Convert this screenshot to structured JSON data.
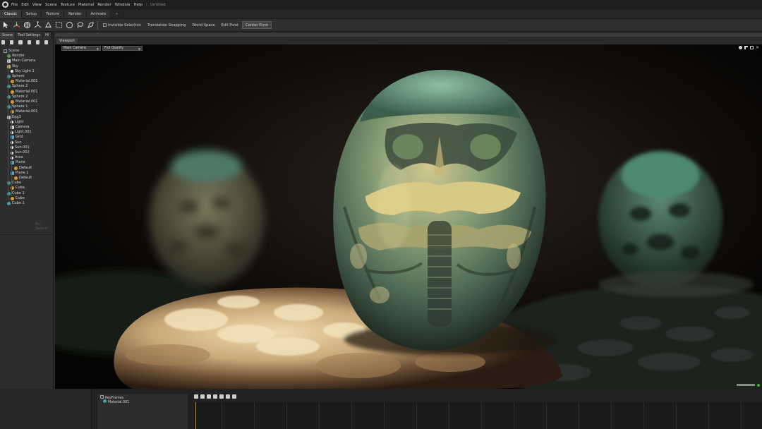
{
  "menubar": {
    "items": [
      "File",
      "Edit",
      "View",
      "Scene",
      "Texture",
      "Material",
      "Render",
      "Window",
      "Help"
    ],
    "document": "Untitled"
  },
  "tabs": {
    "items": [
      {
        "label": "Classic",
        "active": true
      },
      {
        "label": "Setup",
        "active": false
      },
      {
        "label": "Texture",
        "active": false
      },
      {
        "label": "Render",
        "active": false
      },
      {
        "label": "Animate",
        "active": false
      }
    ],
    "add_label": "+"
  },
  "toolbar": {
    "tools": [
      "select-arrow-icon",
      "move-gizmo-icon",
      "rotate-gizmo-icon",
      "scale-gizmo-icon",
      "node-icon",
      "rect-select-icon",
      "circle-select-icon",
      "lasso-icon",
      "paint-select-icon"
    ],
    "invisible_selection": "Invisible Selection",
    "translation_snapping": "Translation Snapping",
    "world_space": "World Space",
    "edit_pivot": "Edit Pivot",
    "center_pivot": "Center Pivot"
  },
  "left_panel": {
    "tabs": [
      "Scene",
      "Tool Settings",
      "Hi"
    ],
    "tree": [
      {
        "label": "Scene",
        "icon": "empty",
        "depth": 0
      },
      {
        "label": "Render",
        "icon": "render",
        "depth": 1
      },
      {
        "label": "Main Camera",
        "icon": "cam",
        "depth": 1
      },
      {
        "label": "Sky",
        "icon": "sky",
        "depth": 1
      },
      {
        "label": "Sky Light 1",
        "icon": "light",
        "depth": 2
      },
      {
        "label": "Sphere",
        "icon": "sphere",
        "depth": 1
      },
      {
        "label": "Material.001",
        "icon": "mat",
        "depth": 2
      },
      {
        "label": "Sphere 2",
        "icon": "sphere",
        "depth": 1
      },
      {
        "label": "Material.001",
        "icon": "mat",
        "depth": 2
      },
      {
        "label": "Sphere 2",
        "icon": "sphere",
        "depth": 1
      },
      {
        "label": "Material.001",
        "icon": "mat",
        "depth": 2
      },
      {
        "label": "Sphere 1",
        "icon": "sphere",
        "depth": 1
      },
      {
        "label": "Material.001",
        "icon": "mat",
        "depth": 2
      },
      {
        "label": "Egg3",
        "icon": "node",
        "depth": 1
      },
      {
        "label": "Light",
        "icon": "light",
        "depth": 2
      },
      {
        "label": "Camera",
        "icon": "cam",
        "depth": 2
      },
      {
        "label": "Light.001",
        "icon": "light",
        "depth": 2
      },
      {
        "label": "Grid",
        "icon": "plane",
        "depth": 2
      },
      {
        "label": "Sun",
        "icon": "light",
        "depth": 2
      },
      {
        "label": "Sun.001",
        "icon": "light",
        "depth": 2
      },
      {
        "label": "Sun.002",
        "icon": "light",
        "depth": 2
      },
      {
        "label": "Area",
        "icon": "light",
        "depth": 2
      },
      {
        "label": "Plane",
        "icon": "plane",
        "depth": 2
      },
      {
        "label": "Default",
        "icon": "mat",
        "depth": 3
      },
      {
        "label": "Plane 1",
        "icon": "plane",
        "depth": 2
      },
      {
        "label": "Default",
        "icon": "mat",
        "depth": 3
      },
      {
        "label": "Cube",
        "icon": "sphere",
        "depth": 1
      },
      {
        "label": "Cube",
        "icon": "mat",
        "depth": 2
      },
      {
        "label": "Cube 1",
        "icon": "sphere",
        "depth": 1
      },
      {
        "label": "Cube",
        "icon": "mat",
        "depth": 2
      },
      {
        "label": "Cube 1",
        "icon": "sphere",
        "depth": 1
      }
    ],
    "no_selection": "No Selecti"
  },
  "viewport": {
    "tab": "Viewport",
    "camera": "Main Camera",
    "quality": "Full Quality"
  },
  "timeline": {
    "tracks": [
      "KeyFrames",
      "Material.001"
    ]
  },
  "colors": {
    "accent_green": "#3ab03a",
    "playhead": "#c98a2b",
    "egg_jade": "#5f8a70",
    "ground_cream": "#d8c39a"
  }
}
